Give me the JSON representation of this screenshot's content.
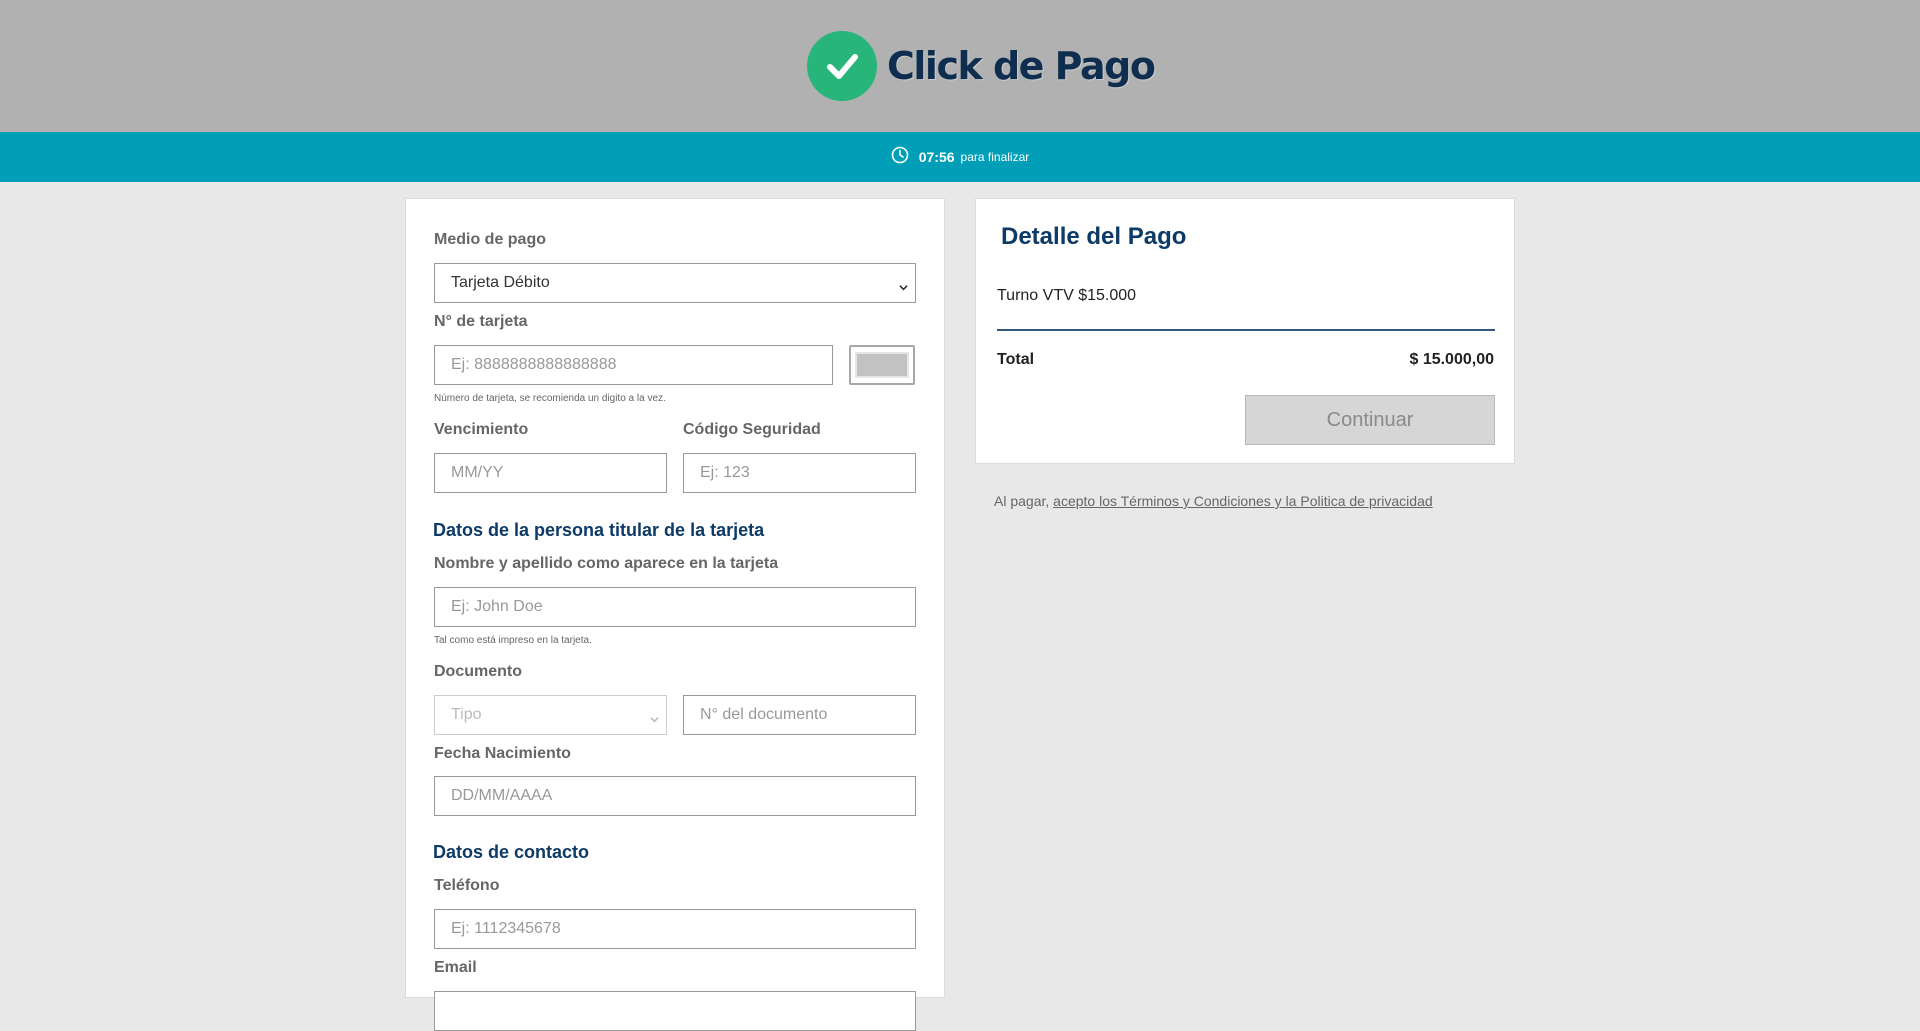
{
  "header": {
    "brand": "Click de Pago",
    "timer": {
      "time": "07:56",
      "label": "para finalizar"
    }
  },
  "form": {
    "payment_method": {
      "label": "Medio de pago",
      "value": "Tarjeta Débito"
    },
    "card_number": {
      "label": "N° de tarjeta",
      "placeholder": "Ej: 8888888888888888",
      "hint": "Número de tarjeta, se recomienda un digito a la vez."
    },
    "expiry": {
      "label": "Vencimiento",
      "placeholder": "MM/YY"
    },
    "security_code": {
      "label": "Código Seguridad",
      "placeholder": "Ej: 123"
    },
    "holder_section": "Datos de la persona titular de la tarjeta",
    "holder_name": {
      "label": "Nombre y apellido como aparece en la tarjeta",
      "placeholder": "Ej: John Doe",
      "hint": "Tal como está impreso en la tarjeta."
    },
    "document": {
      "label": "Documento",
      "type_placeholder": "Tipo",
      "number_placeholder": "N° del documento"
    },
    "birth_date": {
      "label": "Fecha Nacimiento",
      "placeholder": "DD/MM/AAAA"
    },
    "contact_section": "Datos de contacto",
    "phone": {
      "label": "Teléfono",
      "placeholder": "Ej: 1112345678"
    },
    "email": {
      "label": "Email"
    }
  },
  "detail": {
    "title": "Detalle del Pago",
    "item": "Turno VTV $15.000",
    "total_label": "Total",
    "total_value": "$ 15.000,00",
    "continue_label": "Continuar"
  },
  "terms": {
    "prefix": "Al pagar,",
    "link": "acepto los Términos y Condiciones y la Politica de privacidad"
  },
  "colors": {
    "header_bg": "#b1b1b1",
    "timer_bg": "#009fb7",
    "brand_green": "#28b57a",
    "brand_navy": "#0f2e4f",
    "section_title": "#0d3a66"
  },
  "icons": [
    "check-icon",
    "clock-icon",
    "chevron-down-icon",
    "credit-card-icon"
  ]
}
